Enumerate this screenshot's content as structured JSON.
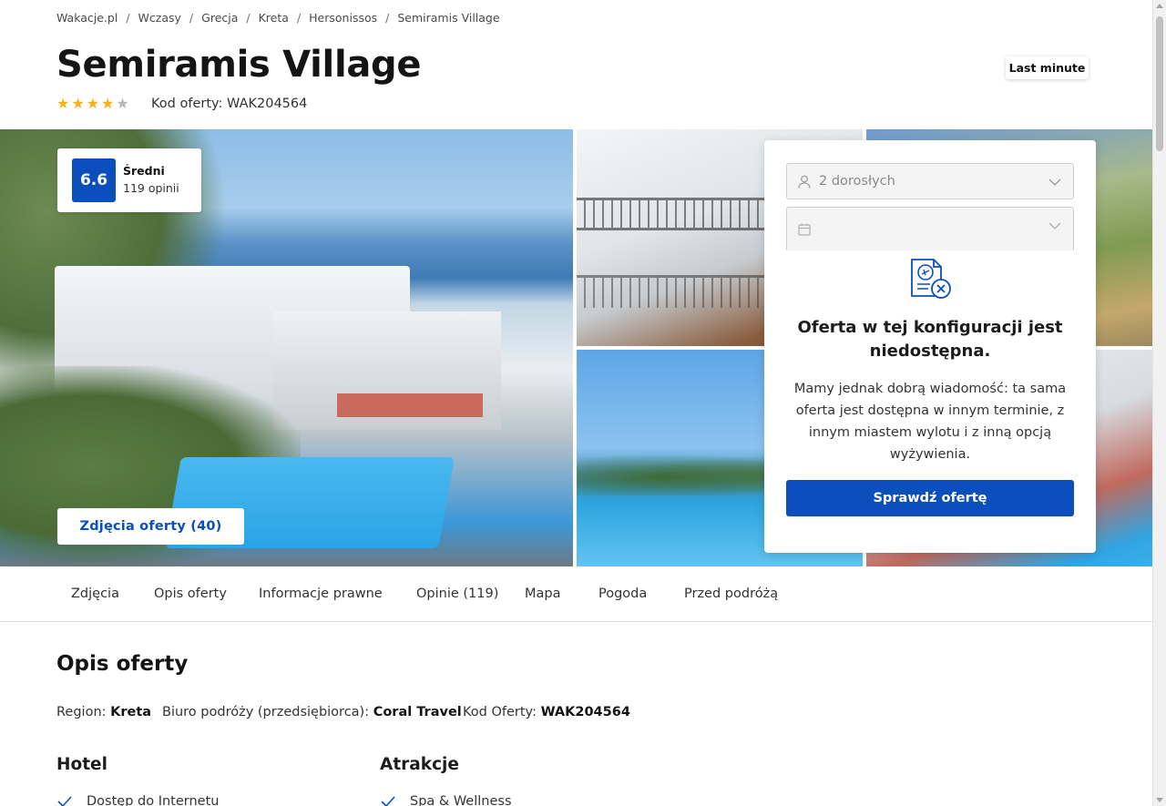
{
  "breadcrumb": [
    "Wakacje.pl",
    "Wczasy",
    "Grecja",
    "Kreta",
    "Hersonissos",
    "Semiramis Village"
  ],
  "hotel": {
    "name": "Semiramis Village",
    "stars": 4,
    "max_stars": 5,
    "offer_code_label": "Kod oferty: WAK204564",
    "badge": "Last minute"
  },
  "rating": {
    "score": "6.6",
    "label": "Średni",
    "reviews": "119 opinii"
  },
  "gallery": {
    "photos_button": "Zdjęcia oferty (40)"
  },
  "booking": {
    "adults_value": "2 dorosłych",
    "date_value": "",
    "unavailable_title": "Oferta w tej konfiguracji jest niedostępna.",
    "unavailable_text": "Mamy jednak dobrą wiadomość: ta sama oferta jest dostępna w innym terminie, z innym miastem wylotu i z inną opcją wyżywienia.",
    "check_button": "Sprawdź ofertę"
  },
  "tabs": [
    "Zdjęcia",
    "Opis oferty",
    "Informacje prawne",
    "Opinie (119)",
    "Mapa",
    "Pogoda",
    "Przed podróżą"
  ],
  "description": {
    "title": "Opis oferty",
    "region_label": "Region:",
    "region_value": "Kreta",
    "operator_label": "Biuro podróży (przedsiębiorca):",
    "operator_value": "Coral Travel",
    "code_label": "Kod Oferty:",
    "code_value": "WAK204564",
    "hotel_heading": "Hotel",
    "attractions_heading": "Atrakcje",
    "hotel_items": [
      "Dostęp do Internetu"
    ],
    "attraction_items": [
      "Spa & Wellness"
    ]
  },
  "colors": {
    "brand_blue": "#0b4fbd",
    "star_gold": "#f3b11a"
  }
}
